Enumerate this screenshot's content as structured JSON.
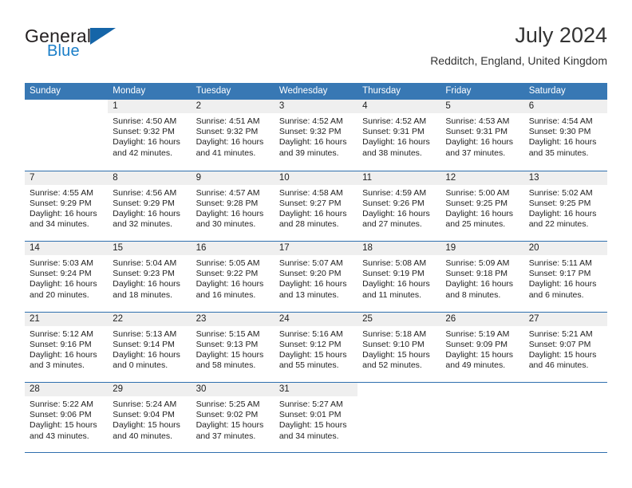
{
  "brand": {
    "line1": "General",
    "line2": "Blue",
    "triangle_color": "#1565a8",
    "blue_color": "#1a7ec8"
  },
  "header": {
    "title": "July 2024",
    "location": "Redditch, England, United Kingdom"
  },
  "theme": {
    "header_band": "#3878b4",
    "week_divider": "#2f6fae",
    "day_number_strip": "#efefef"
  },
  "weekdays": [
    "Sunday",
    "Monday",
    "Tuesday",
    "Wednesday",
    "Thursday",
    "Friday",
    "Saturday"
  ],
  "weeks": [
    [
      {
        "day": "",
        "sunrise": "",
        "sunset": "",
        "daylight1": "",
        "daylight2": "",
        "blank": true
      },
      {
        "day": "1",
        "sunrise": "Sunrise: 4:50 AM",
        "sunset": "Sunset: 9:32 PM",
        "daylight1": "Daylight: 16 hours",
        "daylight2": "and 42 minutes."
      },
      {
        "day": "2",
        "sunrise": "Sunrise: 4:51 AM",
        "sunset": "Sunset: 9:32 PM",
        "daylight1": "Daylight: 16 hours",
        "daylight2": "and 41 minutes."
      },
      {
        "day": "3",
        "sunrise": "Sunrise: 4:52 AM",
        "sunset": "Sunset: 9:32 PM",
        "daylight1": "Daylight: 16 hours",
        "daylight2": "and 39 minutes."
      },
      {
        "day": "4",
        "sunrise": "Sunrise: 4:52 AM",
        "sunset": "Sunset: 9:31 PM",
        "daylight1": "Daylight: 16 hours",
        "daylight2": "and 38 minutes."
      },
      {
        "day": "5",
        "sunrise": "Sunrise: 4:53 AM",
        "sunset": "Sunset: 9:31 PM",
        "daylight1": "Daylight: 16 hours",
        "daylight2": "and 37 minutes."
      },
      {
        "day": "6",
        "sunrise": "Sunrise: 4:54 AM",
        "sunset": "Sunset: 9:30 PM",
        "daylight1": "Daylight: 16 hours",
        "daylight2": "and 35 minutes."
      }
    ],
    [
      {
        "day": "7",
        "sunrise": "Sunrise: 4:55 AM",
        "sunset": "Sunset: 9:29 PM",
        "daylight1": "Daylight: 16 hours",
        "daylight2": "and 34 minutes."
      },
      {
        "day": "8",
        "sunrise": "Sunrise: 4:56 AM",
        "sunset": "Sunset: 9:29 PM",
        "daylight1": "Daylight: 16 hours",
        "daylight2": "and 32 minutes."
      },
      {
        "day": "9",
        "sunrise": "Sunrise: 4:57 AM",
        "sunset": "Sunset: 9:28 PM",
        "daylight1": "Daylight: 16 hours",
        "daylight2": "and 30 minutes."
      },
      {
        "day": "10",
        "sunrise": "Sunrise: 4:58 AM",
        "sunset": "Sunset: 9:27 PM",
        "daylight1": "Daylight: 16 hours",
        "daylight2": "and 28 minutes."
      },
      {
        "day": "11",
        "sunrise": "Sunrise: 4:59 AM",
        "sunset": "Sunset: 9:26 PM",
        "daylight1": "Daylight: 16 hours",
        "daylight2": "and 27 minutes."
      },
      {
        "day": "12",
        "sunrise": "Sunrise: 5:00 AM",
        "sunset": "Sunset: 9:25 PM",
        "daylight1": "Daylight: 16 hours",
        "daylight2": "and 25 minutes."
      },
      {
        "day": "13",
        "sunrise": "Sunrise: 5:02 AM",
        "sunset": "Sunset: 9:25 PM",
        "daylight1": "Daylight: 16 hours",
        "daylight2": "and 22 minutes."
      }
    ],
    [
      {
        "day": "14",
        "sunrise": "Sunrise: 5:03 AM",
        "sunset": "Sunset: 9:24 PM",
        "daylight1": "Daylight: 16 hours",
        "daylight2": "and 20 minutes."
      },
      {
        "day": "15",
        "sunrise": "Sunrise: 5:04 AM",
        "sunset": "Sunset: 9:23 PM",
        "daylight1": "Daylight: 16 hours",
        "daylight2": "and 18 minutes."
      },
      {
        "day": "16",
        "sunrise": "Sunrise: 5:05 AM",
        "sunset": "Sunset: 9:22 PM",
        "daylight1": "Daylight: 16 hours",
        "daylight2": "and 16 minutes."
      },
      {
        "day": "17",
        "sunrise": "Sunrise: 5:07 AM",
        "sunset": "Sunset: 9:20 PM",
        "daylight1": "Daylight: 16 hours",
        "daylight2": "and 13 minutes."
      },
      {
        "day": "18",
        "sunrise": "Sunrise: 5:08 AM",
        "sunset": "Sunset: 9:19 PM",
        "daylight1": "Daylight: 16 hours",
        "daylight2": "and 11 minutes."
      },
      {
        "day": "19",
        "sunrise": "Sunrise: 5:09 AM",
        "sunset": "Sunset: 9:18 PM",
        "daylight1": "Daylight: 16 hours",
        "daylight2": "and 8 minutes."
      },
      {
        "day": "20",
        "sunrise": "Sunrise: 5:11 AM",
        "sunset": "Sunset: 9:17 PM",
        "daylight1": "Daylight: 16 hours",
        "daylight2": "and 6 minutes."
      }
    ],
    [
      {
        "day": "21",
        "sunrise": "Sunrise: 5:12 AM",
        "sunset": "Sunset: 9:16 PM",
        "daylight1": "Daylight: 16 hours",
        "daylight2": "and 3 minutes."
      },
      {
        "day": "22",
        "sunrise": "Sunrise: 5:13 AM",
        "sunset": "Sunset: 9:14 PM",
        "daylight1": "Daylight: 16 hours",
        "daylight2": "and 0 minutes."
      },
      {
        "day": "23",
        "sunrise": "Sunrise: 5:15 AM",
        "sunset": "Sunset: 9:13 PM",
        "daylight1": "Daylight: 15 hours",
        "daylight2": "and 58 minutes."
      },
      {
        "day": "24",
        "sunrise": "Sunrise: 5:16 AM",
        "sunset": "Sunset: 9:12 PM",
        "daylight1": "Daylight: 15 hours",
        "daylight2": "and 55 minutes."
      },
      {
        "day": "25",
        "sunrise": "Sunrise: 5:18 AM",
        "sunset": "Sunset: 9:10 PM",
        "daylight1": "Daylight: 15 hours",
        "daylight2": "and 52 minutes."
      },
      {
        "day": "26",
        "sunrise": "Sunrise: 5:19 AM",
        "sunset": "Sunset: 9:09 PM",
        "daylight1": "Daylight: 15 hours",
        "daylight2": "and 49 minutes."
      },
      {
        "day": "27",
        "sunrise": "Sunrise: 5:21 AM",
        "sunset": "Sunset: 9:07 PM",
        "daylight1": "Daylight: 15 hours",
        "daylight2": "and 46 minutes."
      }
    ],
    [
      {
        "day": "28",
        "sunrise": "Sunrise: 5:22 AM",
        "sunset": "Sunset: 9:06 PM",
        "daylight1": "Daylight: 15 hours",
        "daylight2": "and 43 minutes."
      },
      {
        "day": "29",
        "sunrise": "Sunrise: 5:24 AM",
        "sunset": "Sunset: 9:04 PM",
        "daylight1": "Daylight: 15 hours",
        "daylight2": "and 40 minutes."
      },
      {
        "day": "30",
        "sunrise": "Sunrise: 5:25 AM",
        "sunset": "Sunset: 9:02 PM",
        "daylight1": "Daylight: 15 hours",
        "daylight2": "and 37 minutes."
      },
      {
        "day": "31",
        "sunrise": "Sunrise: 5:27 AM",
        "sunset": "Sunset: 9:01 PM",
        "daylight1": "Daylight: 15 hours",
        "daylight2": "and 34 minutes."
      },
      {
        "day": "",
        "sunrise": "",
        "sunset": "",
        "daylight1": "",
        "daylight2": "",
        "blank": true
      },
      {
        "day": "",
        "sunrise": "",
        "sunset": "",
        "daylight1": "",
        "daylight2": "",
        "blank": true
      },
      {
        "day": "",
        "sunrise": "",
        "sunset": "",
        "daylight1": "",
        "daylight2": "",
        "blank": true
      }
    ]
  ]
}
